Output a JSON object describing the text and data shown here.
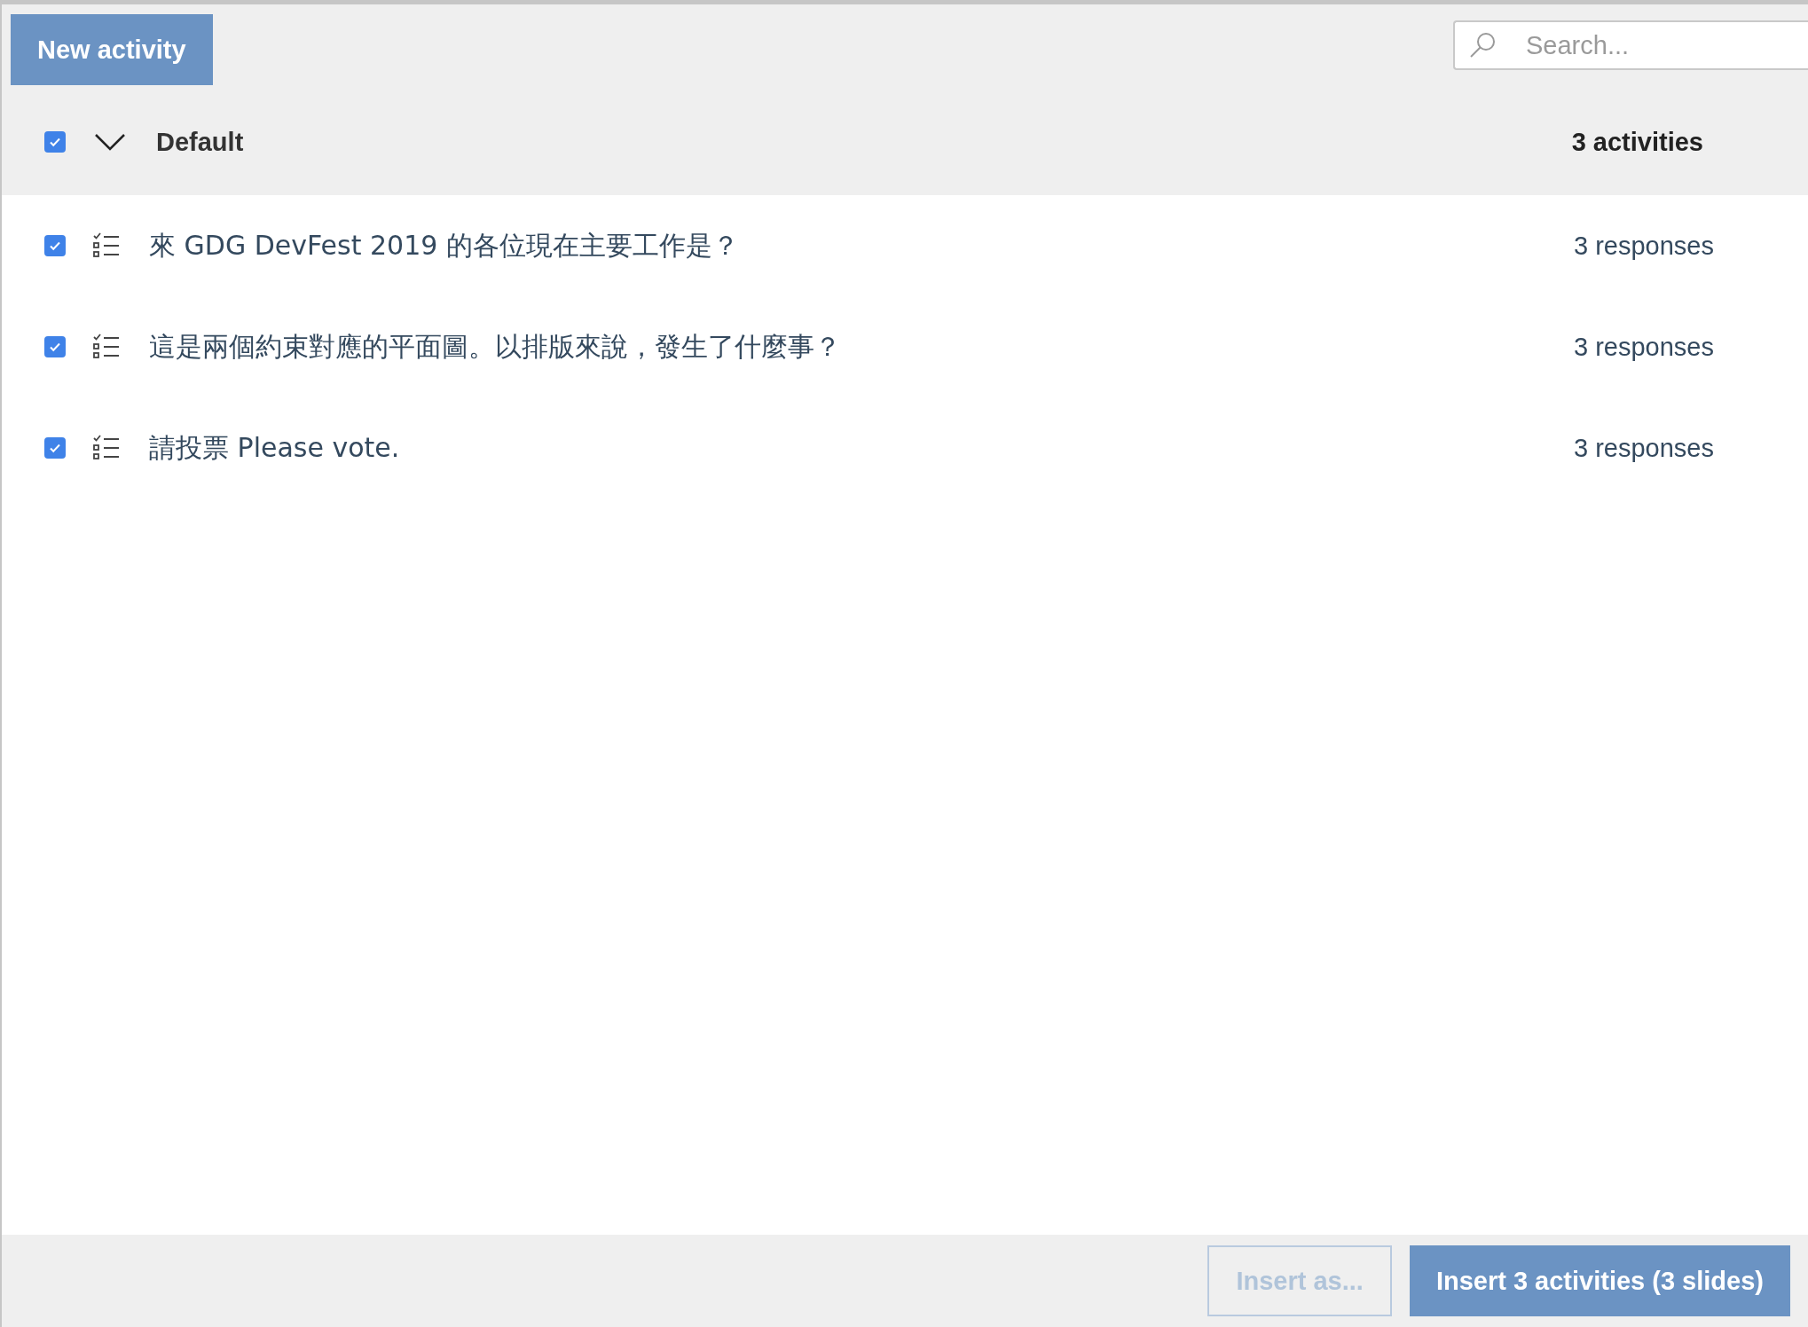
{
  "toolbar": {
    "new_button": "New activity",
    "search": {
      "placeholder": "Search..."
    }
  },
  "group": {
    "name": "Default",
    "checked": true,
    "expanded": true,
    "count": "3 activities",
    "activities": [
      {
        "title": "來 GDG DevFest 2019 的各位現在主要工作是？",
        "responses": "3 responses",
        "checked": true
      },
      {
        "title": "這是兩個約束對應的平面圖。以排版來說，發生了什麼事？",
        "responses": "3 responses",
        "checked": true
      },
      {
        "title": "請投票 Please vote.",
        "responses": "3 responses",
        "checked": true
      }
    ]
  },
  "footer": {
    "buttons": [
      {
        "label": "Insert as...",
        "disabled": true,
        "kind": "secondary"
      },
      {
        "label": "Insert 3 activities (3 slides)",
        "disabled": false,
        "kind": "primary"
      }
    ]
  }
}
